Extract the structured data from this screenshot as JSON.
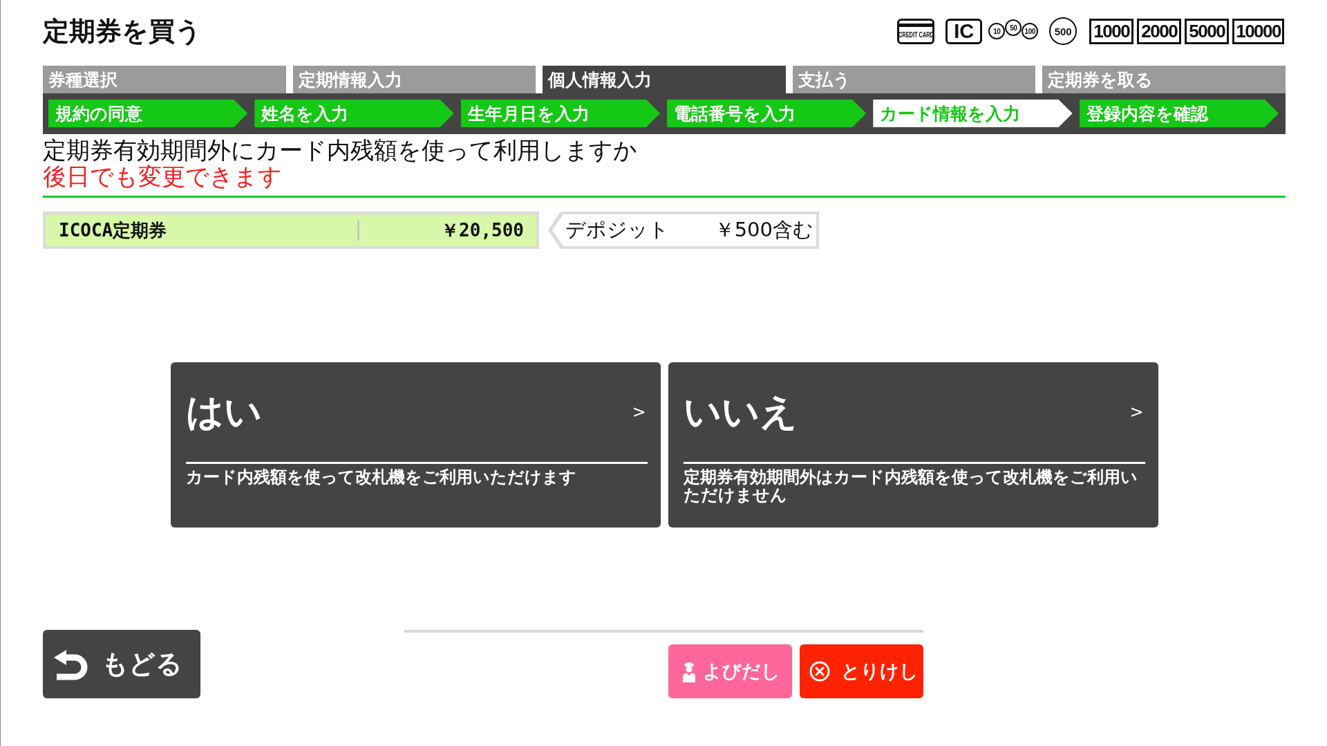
{
  "header": {
    "title": "定期券を買う",
    "accepted_payments": [
      {
        "kind": "credit_card",
        "label": "CREDIT CARD"
      },
      {
        "kind": "ic_card",
        "label": "IC"
      },
      {
        "kind": "coins",
        "labels": [
          "10",
          "50",
          "100"
        ]
      },
      {
        "kind": "coin",
        "label": "500"
      },
      {
        "kind": "note",
        "label": "1000"
      },
      {
        "kind": "note",
        "label": "2000"
      },
      {
        "kind": "note",
        "label": "5000"
      },
      {
        "kind": "note",
        "label": "10000"
      }
    ]
  },
  "steps": [
    {
      "label": "券種選択",
      "selected": false
    },
    {
      "label": "定期情報入力",
      "selected": false
    },
    {
      "label": "個人情報入力",
      "selected": true
    },
    {
      "label": "支払う",
      "selected": false
    },
    {
      "label": "定期券を取る",
      "selected": false
    }
  ],
  "substeps": [
    {
      "label": "規約の同意",
      "selected": false
    },
    {
      "label": "姓名を入力",
      "selected": false
    },
    {
      "label": "生年月日を入力",
      "selected": false
    },
    {
      "label": "電話番号を入力",
      "selected": false
    },
    {
      "label": "カード情報を入力",
      "selected": true
    },
    {
      "label": "登録内容を確認",
      "selected": false
    }
  ],
  "question": {
    "text": "定期券有効期間外にカード内残額を使って利用しますか",
    "note": "後日でも変更できます"
  },
  "ticket": {
    "name": "ICOCA定期券",
    "price": "￥20,500"
  },
  "deposit": {
    "label": "デポジット",
    "amount": "￥500含む"
  },
  "choices": [
    {
      "label": "はい",
      "arrow": ">",
      "description": "カード内残額を使って改札機をご利用いただけます"
    },
    {
      "label": "いいえ",
      "arrow": ">",
      "description": "定期券有効期間外はカード内残額を使って改札機をご利用いただけません"
    }
  ],
  "back_button": {
    "label": "もどる"
  },
  "actions": [
    {
      "kind": "call",
      "label": "よびだし"
    },
    {
      "kind": "cancel",
      "label": "とりけし"
    }
  ]
}
